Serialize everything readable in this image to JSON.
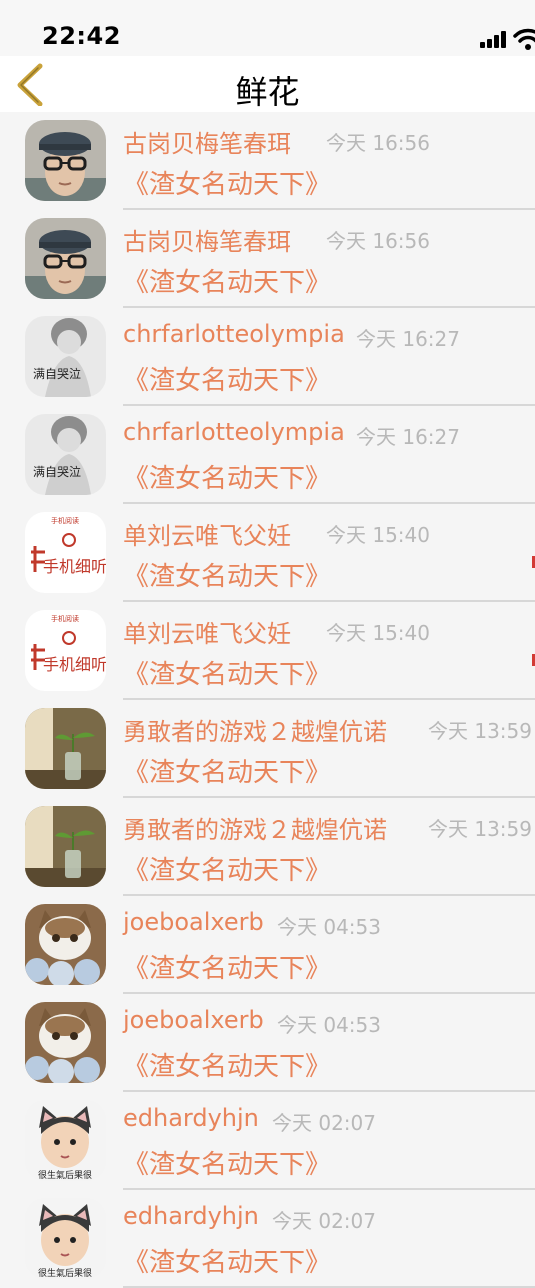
{
  "status_bar": {
    "time": "22:42"
  },
  "nav": {
    "title": "鲜花",
    "back_icon": "chevron-left-icon"
  },
  "colors": {
    "accent": "#e8845a",
    "time_gray": "#b8b8b8",
    "divider": "#d7d7d7"
  },
  "rows": [
    {
      "name": "古岗贝梅笔春珥",
      "time": "今天 16:56",
      "book": "《渣女名动天下》",
      "avatar": "boy-with-glasses"
    },
    {
      "name": "古岗贝梅笔春珥",
      "time": "今天 16:56",
      "book": "《渣女名动天下》",
      "avatar": "boy-with-glasses"
    },
    {
      "name": "chrfarlotteolympia",
      "time": "今天 16:27",
      "book": "《渣女名动天下》",
      "avatar": "girl-bw-text"
    },
    {
      "name": "chrfarlotteolympia",
      "time": "今天 16:27",
      "book": "《渣女名动天下》",
      "avatar": "girl-bw-text"
    },
    {
      "name": "单刘云唯飞父妊",
      "time": "今天 15:40",
      "book": "《渣女名动天下》",
      "avatar": "red-handwriting-logo"
    },
    {
      "name": "单刘云唯飞父妊",
      "time": "今天 15:40",
      "book": "《渣女名动天下》",
      "avatar": "red-handwriting-logo"
    },
    {
      "name": "勇敢者的游戏２越煌伉诺",
      "time": "今天 13:59",
      "book": "《渣女名动天下》",
      "avatar": "plant-in-bottle"
    },
    {
      "name": "勇敢者的游戏２越煌伉诺",
      "time": "今天 13:59",
      "book": "《渣女名动天下》",
      "avatar": "plant-in-bottle"
    },
    {
      "name": "joeboalxerb",
      "time": "今天 04:53",
      "book": "《渣女名动天下》",
      "avatar": "cat-with-flowers"
    },
    {
      "name": "joeboalxerb",
      "time": "今天 04:53",
      "book": "《渣女名动天下》",
      "avatar": "cat-with-flowers"
    },
    {
      "name": "edhardyhjn",
      "time": "今天 02:07",
      "book": "《渣女名动天下》",
      "avatar": "cat-ear-cartoon"
    },
    {
      "name": "edhardyhjn",
      "time": "今天 02:07",
      "book": "《渣女名动天下》",
      "avatar": "cat-ear-cartoon"
    }
  ],
  "avatar_texts": {
    "girl": "满自哭泣",
    "logo_top": "手机阅读",
    "logo_main": "手机细听",
    "cartoon": "很生氣后果很"
  }
}
